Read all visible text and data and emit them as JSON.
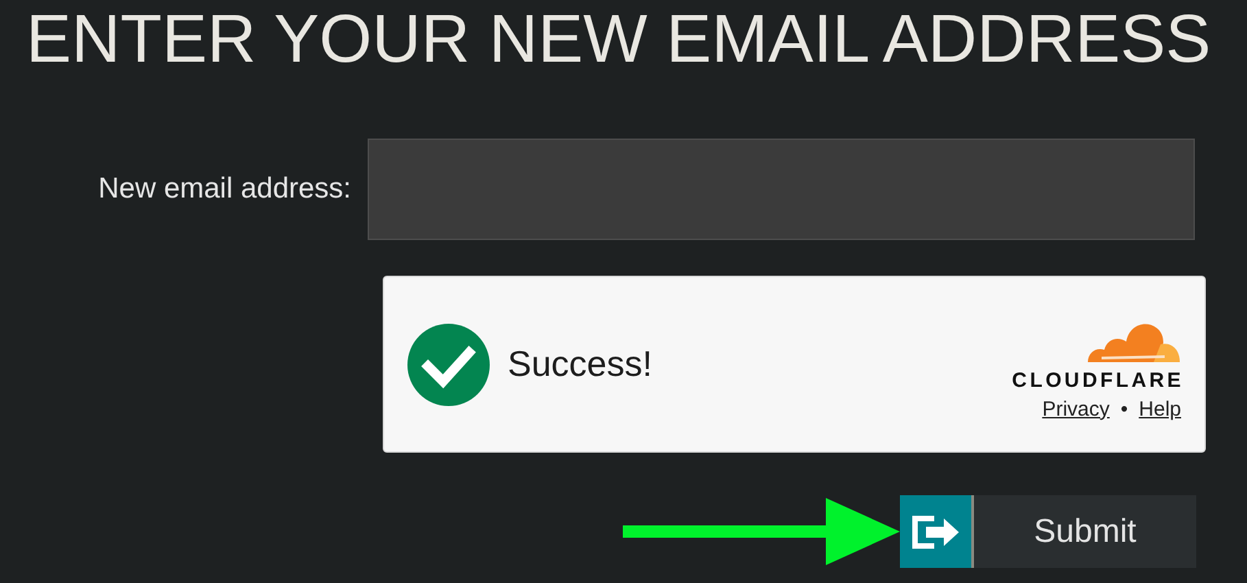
{
  "heading": "ENTER YOUR NEW EMAIL ADDRESS",
  "email_field": {
    "label": "New email address:"
  },
  "captcha": {
    "verified": true,
    "message": "Success!",
    "brand": "CLOUDFLARE",
    "links": [
      "Privacy",
      "Help"
    ],
    "separator": "•"
  },
  "submit_button": {
    "label": "Submit"
  }
}
